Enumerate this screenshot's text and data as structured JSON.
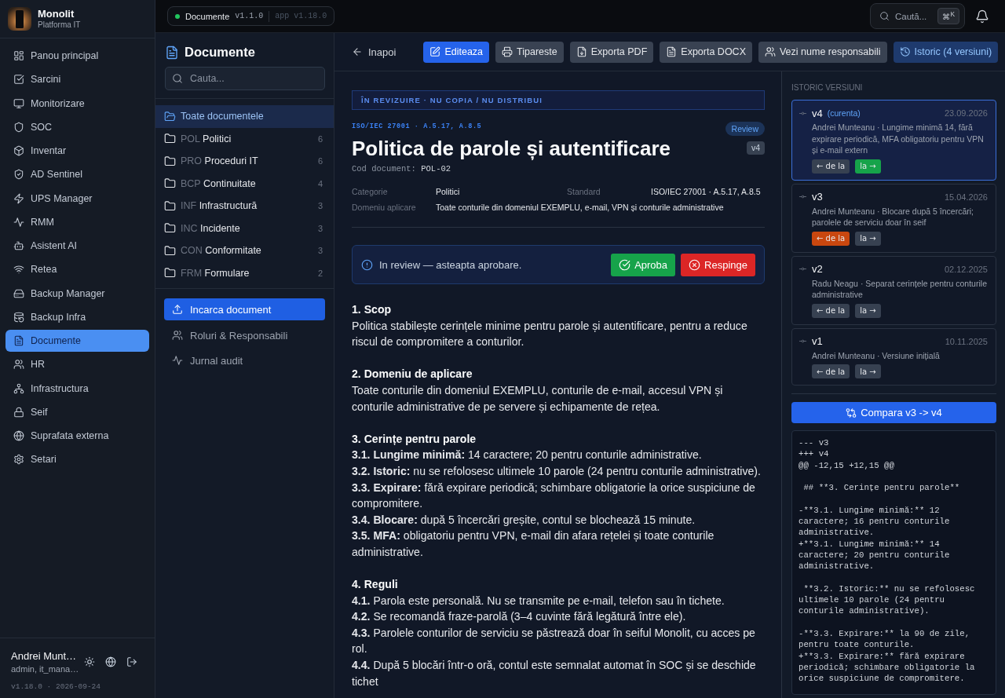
{
  "app": {
    "name": "Monolit",
    "subtitle": "Platforma IT"
  },
  "nav": [
    {
      "label": "Panou principal",
      "selected": false
    },
    {
      "label": "Sarcini",
      "selected": false
    },
    {
      "label": "Monitorizare",
      "selected": false
    },
    {
      "label": "SOC",
      "selected": false
    },
    {
      "label": "Inventar",
      "selected": false
    },
    {
      "label": "AD Sentinel",
      "selected": false
    },
    {
      "label": "UPS Manager",
      "selected": false
    },
    {
      "label": "RMM",
      "selected": false
    },
    {
      "label": "Asistent AI",
      "selected": false
    },
    {
      "label": "Retea",
      "selected": false
    },
    {
      "label": "Backup Manager",
      "selected": false
    },
    {
      "label": "Backup Infra",
      "selected": false
    },
    {
      "label": "Documente",
      "selected": true
    },
    {
      "label": "HR",
      "selected": false
    },
    {
      "label": "Infrastructura",
      "selected": false
    },
    {
      "label": "Seif",
      "selected": false
    },
    {
      "label": "Suprafata externa",
      "selected": false
    },
    {
      "label": "Setari",
      "selected": false
    }
  ],
  "user": {
    "name": "Andrei Munt…",
    "roles": "admin, it_mana…",
    "build": "v1.18.0 · 2026-09-24"
  },
  "topbar": {
    "module": "Documente",
    "module_active": true,
    "module_version": "v1.1.0",
    "app_version": "app v1.18.0",
    "search_placeholder": "Caută...",
    "shortcut": "⌘$^{K}$"
  },
  "docnav": {
    "title": "Documente",
    "search_placeholder": "Cauta...",
    "folders": [
      {
        "name": "Toate documentele",
        "selected": true
      },
      {
        "code": "POL",
        "name": "Politici",
        "count": "6",
        "selected": false
      },
      {
        "code": "PRO",
        "name": "Proceduri IT",
        "count": "6",
        "selected": false
      },
      {
        "code": "BCP",
        "name": "Continuitate",
        "count": "4",
        "selected": false
      },
      {
        "code": "INF",
        "name": "Infrastructură",
        "count": "3",
        "selected": false
      },
      {
        "code": "INC",
        "name": "Incidente",
        "count": "3",
        "selected": false
      },
      {
        "code": "CON",
        "name": "Conformitate",
        "count": "3",
        "selected": false
      },
      {
        "code": "FRM",
        "name": "Formulare",
        "count": "2",
        "selected": false
      }
    ],
    "upload": "Incarca document",
    "links": [
      "Roluri & Responsabili",
      "Jurnal audit"
    ]
  },
  "toolbar": {
    "back": "Inapoi",
    "buttons": [
      {
        "label": "Editeaza",
        "kind": "primary"
      },
      {
        "label": "Tipareste",
        "kind": "default"
      },
      {
        "label": "Exporta PDF",
        "kind": "default"
      },
      {
        "label": "Exporta DOCX",
        "kind": "default"
      },
      {
        "label": "Vezi nume responsabili",
        "kind": "default"
      },
      {
        "label": "Istoric (4 versiuni)",
        "kind": "active"
      }
    ]
  },
  "document": {
    "watermark": "ÎN REVIZUIRE · NU COPIA / NU DISTRIBUI",
    "standard": "ISO/IEC 27001 · A.5.17, A.8.5",
    "status": "Review",
    "version": "v4",
    "title": "Politica de parole și autentificare",
    "code_label": "Cod document:",
    "code": "POL-02",
    "meta": [
      [
        {
          "label": "Categorie",
          "value": "Politici"
        },
        {
          "label": "Standard",
          "value": "ISO/IEC 27001 · A.5.17, A.8.5"
        }
      ],
      [
        {
          "label": "Domeniu aplicare",
          "value": "Toate conturile din domeniul EXEMPLU, e-mail, VPN și conturile administrative"
        }
      ]
    ],
    "review": {
      "message": "In review — asteapta aprobare.",
      "actions": [
        {
          "label": "Aproba",
          "kind": "approve"
        },
        {
          "label": "Respinge",
          "kind": "reject"
        }
      ]
    },
    "sections": [
      {
        "heading": "1. Scop",
        "paragraphs": [
          "Politica stabilește cerințele minime pentru parole și autentificare, pentru a reduce riscul de compromitere a conturilor."
        ]
      },
      {
        "heading": "2. Domeniu de aplicare",
        "paragraphs": [
          "Toate conturile din domeniul EXEMPLU, conturile de e-mail, accesul VPN și conturile administrative de pe servere și echipamente de rețea."
        ]
      },
      {
        "heading": "3. Cerințe pentru parole",
        "paragraphs": [
          "**3.1. Lungime minimă:** 14 caractere; 20 pentru conturile administrative.",
          "**3.2. Istoric:** nu se refolosesc ultimele 10 parole (24 pentru conturile administrative).",
          "**3.3. Expirare:** fără expirare periodică; schimbare obligatorie la orice suspiciune de compromitere.",
          "**3.4. Blocare:** după 5 încercări greșite, contul se blochează 15 minute.",
          "**3.5. MFA:** obligatoriu pentru VPN, e-mail din afara rețelei și toate conturile administrative."
        ]
      },
      {
        "heading": "4. Reguli",
        "paragraphs": [
          "**4.1.** Parola este personală. Nu se transmite pe e-mail, telefon sau în tichete.",
          "**4.2.** Se recomandă fraze-parolă (3–4 cuvinte fără legătură între ele).",
          "**4.3.** Parolele conturilor de serviciu se păstrează doar în seiful Monolit, cu acces pe rol.",
          "**4.4.** După 5 blocări într-o oră, contul este semnalat automat în SOC și se deschide tichet"
        ]
      }
    ]
  },
  "history": {
    "title": "ISTORIC VERSIUNI",
    "versions": [
      {
        "version": "v4",
        "note": "(curenta)",
        "date": "23.09.2026",
        "summary": "Andrei Munteanu · Lungime minimă 14, fără expirare periodică, MFA obligatoriu pentru VPN și e-mail extern",
        "selected": true,
        "from_label": "← de la",
        "to_label": "la →",
        "from_selected": false,
        "to_selected": true
      },
      {
        "version": "v3",
        "date": "15.04.2026",
        "summary": "Andrei Munteanu · Blocare după 5 încercări; parolele de serviciu doar în seif",
        "selected": false,
        "from_label": "← de la",
        "to_label": "la →",
        "from_selected": true,
        "to_selected": false
      },
      {
        "version": "v2",
        "date": "02.12.2025",
        "summary": "Radu Neagu · Separat cerințele pentru conturile administrative",
        "selected": false,
        "from_label": "← de la",
        "to_label": "la →",
        "from_selected": false,
        "to_selected": false
      },
      {
        "version": "v1",
        "date": "10.11.2025",
        "summary": "Andrei Munteanu · Versiune inițială",
        "selected": false,
        "from_label": "← de la",
        "to_label": "la →",
        "from_selected": false,
        "to_selected": false
      }
    ],
    "compare": "Compara v3 -> v4",
    "diff": "--- v3\n+++ v4\n@@ -12,15 +12,15 @@\n\n ## **3. Cerințe pentru parole**\n\n-**3.1. Lungime minimă:** 12 caractere; 16 pentru conturile administrative.\n+**3.1. Lungime minimă:** 14 caractere; 20 pentru conturile administrative.\n\n **3.2. Istoric:** nu se refolosesc ultimele 10 parole (24 pentru conturile administrative).\n\n-**3.3. Expirare:** la 90 de zile, pentru toate conturile.\n+**3.3. Expirare:** fără expirare periodică; schimbare obligatorie la orice suspiciune de compromitere."
  }
}
